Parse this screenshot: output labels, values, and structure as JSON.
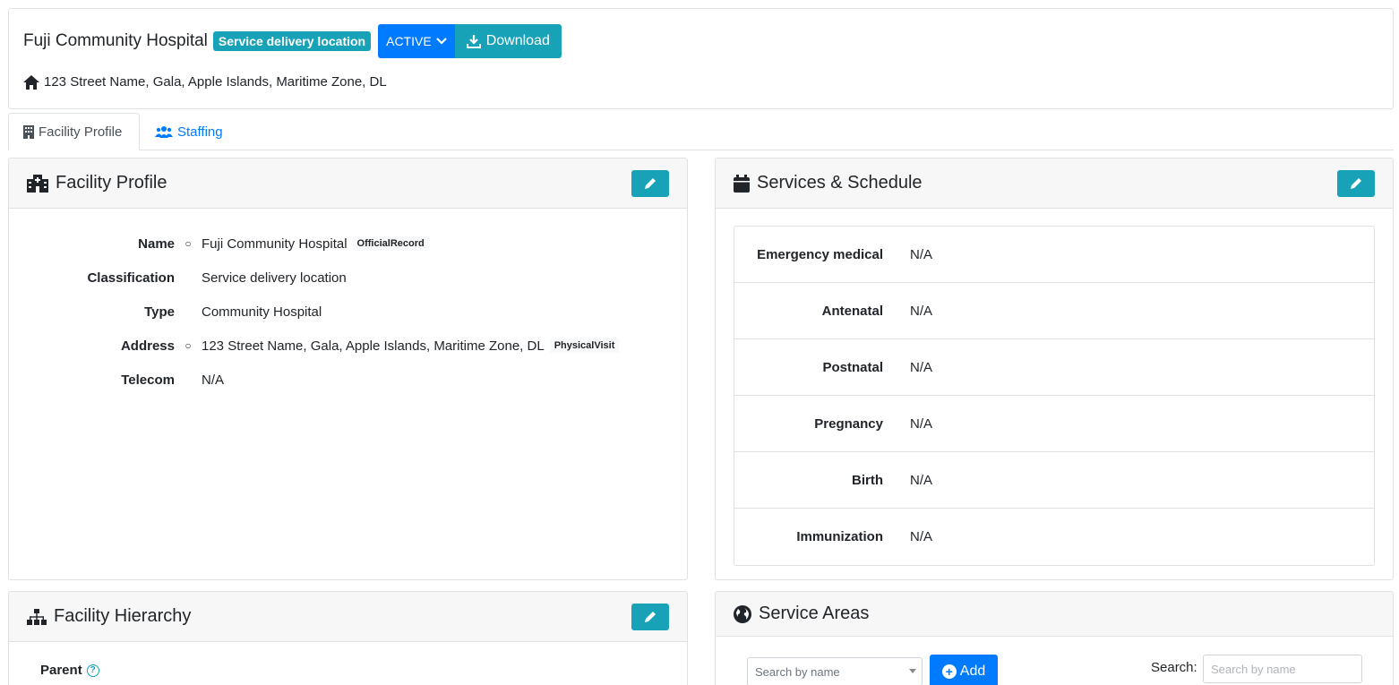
{
  "header": {
    "title": "Fuji Community Hospital",
    "type_badge": "Service delivery location",
    "status_button": "ACTIVE",
    "download_button": "Download",
    "address": "123 Street Name, Gala, Apple Islands, Maritime Zone, DL"
  },
  "tabs": [
    {
      "label": "Facility Profile",
      "icon": "building-icon",
      "active": true
    },
    {
      "label": "Staffing",
      "icon": "users-icon",
      "active": false
    }
  ],
  "facility_profile": {
    "title": "Facility Profile",
    "rows": [
      {
        "label": "Name",
        "value": "Fuji Community Hospital",
        "tag": "OfficialRecord",
        "bullet": "○"
      },
      {
        "label": "Classification",
        "value": "Service delivery location"
      },
      {
        "label": "Type",
        "value": "Community Hospital"
      },
      {
        "label": "Address",
        "value": "123 Street Name, Gala, Apple Islands, Maritime Zone, DL",
        "tag": "PhysicalVisit",
        "bullet": "○"
      },
      {
        "label": "Telecom",
        "value": "N/A"
      }
    ]
  },
  "services_schedule": {
    "title": "Services & Schedule",
    "rows": [
      {
        "label": "Emergency medical",
        "value": "N/A"
      },
      {
        "label": "Antenatal",
        "value": "N/A"
      },
      {
        "label": "Postnatal",
        "value": "N/A"
      },
      {
        "label": "Pregnancy",
        "value": "N/A"
      },
      {
        "label": "Birth",
        "value": "N/A"
      },
      {
        "label": "Immunization",
        "value": "N/A"
      }
    ]
  },
  "facility_hierarchy": {
    "title": "Facility Hierarchy",
    "parent_label": "Parent",
    "help_glyph": "?"
  },
  "service_areas": {
    "title": "Service Areas",
    "select_placeholder": "Search by name",
    "add_button": "Add",
    "search_label": "Search:",
    "search_placeholder": "Search by name"
  },
  "colors": {
    "primary": "#007bff",
    "info": "#17a2b8"
  }
}
